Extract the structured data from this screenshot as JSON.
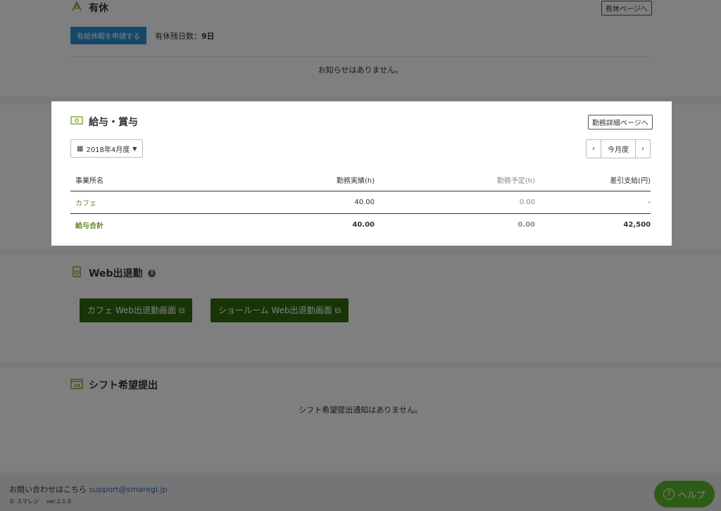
{
  "paid_leave": {
    "title": "有休",
    "page_button": "有休ページへ",
    "apply_button": "有給休暇を申請する",
    "remaining_label": "有休残日数：",
    "remaining_value": "9日",
    "notice": "お知らせはありません。"
  },
  "salary": {
    "title": "給与・賞与",
    "detail_button": "勤務詳細ページへ",
    "period_dropdown": "2018年4月度",
    "prev": "‹",
    "current_month": "今月度",
    "next": "›",
    "columns": [
      "事業所名",
      "勤務実績(h)",
      "勤務予定(h)",
      "差引支給(円)"
    ],
    "rows": [
      {
        "name": "カフェ",
        "actual": "40.00",
        "planned": "0.00",
        "pay": "-"
      }
    ],
    "total": {
      "name": "給与合計",
      "actual": "40.00",
      "planned": "0.00",
      "pay": "42,500"
    }
  },
  "web_attendance": {
    "title": "Web出退勤",
    "buttons": [
      "カフェ Web出退勤画面",
      "ショールーム Web出退勤画面"
    ]
  },
  "shift": {
    "title": "シフト希望提出",
    "notice": "シフト希望提出通知はありません。"
  },
  "footer": {
    "contact_label": "お問い合わせはこちら",
    "contact_email": "support@smaregi.jp",
    "copyright": "© スマレジ",
    "version": "ver.2.1.0"
  },
  "help_button": "ヘルプ",
  "colors": {
    "accent_green": "#7aa82c",
    "button_green": "#2e6b0c",
    "button_blue": "#2b93d6",
    "help_green": "#5cb82e"
  }
}
